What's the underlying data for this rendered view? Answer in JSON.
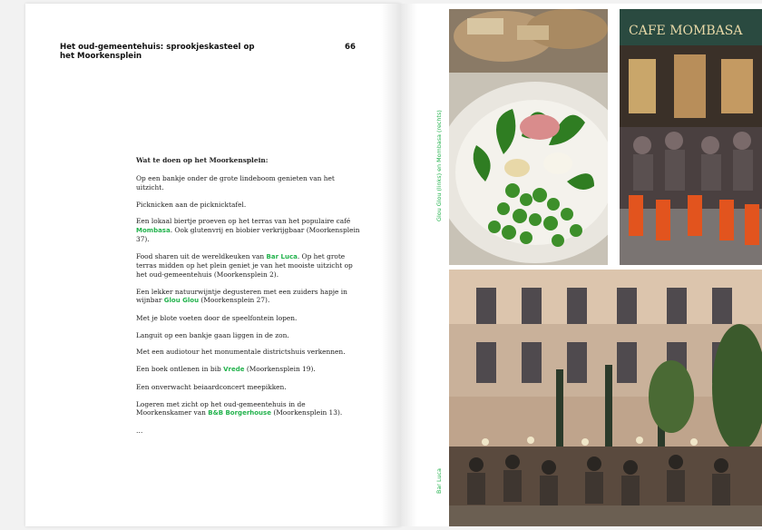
{
  "left_page": {
    "chapter_title": "Het oud-gemeentehuis: sprookjeskasteel op het Moorkensplein",
    "page_number": "66",
    "heading": "Wat te doen op het Moorkensplein:",
    "paragraphs": [
      {
        "text": "Op een bankje onder de grote lindeboom genieten van het uitzicht."
      },
      {
        "text": "Picknicken aan de picknicktafel."
      },
      {
        "before": "Een lokaal biertje proeven op het terras van het populaire café ",
        "venue": "Mombasa",
        "after": ". Ook glutenvrij en biobier verkrijgbaar (Moorkensplein 37)."
      },
      {
        "before": "Food sharen uit de wereldkeuken van ",
        "venue": "Bar Luca",
        "after": ". Op het grote terras midden op het plein geniet je van het mooiste uitzicht op het oud-gemeentehuis (Moorkensplein 2)."
      },
      {
        "before": "Een lekker natuurwijntje degusteren met een zuiders hapje in wijnbar ",
        "venue": "Glou Glou",
        "after": " (Moorkensplein 27)."
      },
      {
        "text": "Met je blote voeten door de speelfontein lopen."
      },
      {
        "text": "Languit op een bankje gaan liggen in de zon."
      },
      {
        "text": "Met een audiotour het monumentale districtshuis verkennen."
      },
      {
        "before": "Een boek ontlenen in bib ",
        "venue": "Vrede",
        "after": " (Moorkensplein 19)."
      },
      {
        "text": "Een onverwacht beiaardconcert meepikken."
      },
      {
        "before": "Logeren met zicht op het oud-gemeentehuis in de Moorkenskamer van ",
        "venue": "B&B Borgerhouse",
        "after": " (Moorkensplein 13)."
      },
      {
        "text": "…"
      }
    ]
  },
  "right_page": {
    "caption_top": "Glou Glou (links) en Mombasa (rechts)",
    "caption_bottom": "Bar Luca",
    "photos": [
      {
        "name": "glou-glou-dish-photo",
        "subject": "plate of greens and peas"
      },
      {
        "name": "mombasa-terrace-photo",
        "subject": "cafe terrace with red chairs",
        "sign_text": "CAFE MOMBASA"
      },
      {
        "name": "bar-luca-terrace-photo",
        "subject": "evening terrace before the town hall"
      }
    ]
  },
  "colors": {
    "accent_green": "#22b24c",
    "text": "#222222",
    "page": "#ffffff"
  }
}
